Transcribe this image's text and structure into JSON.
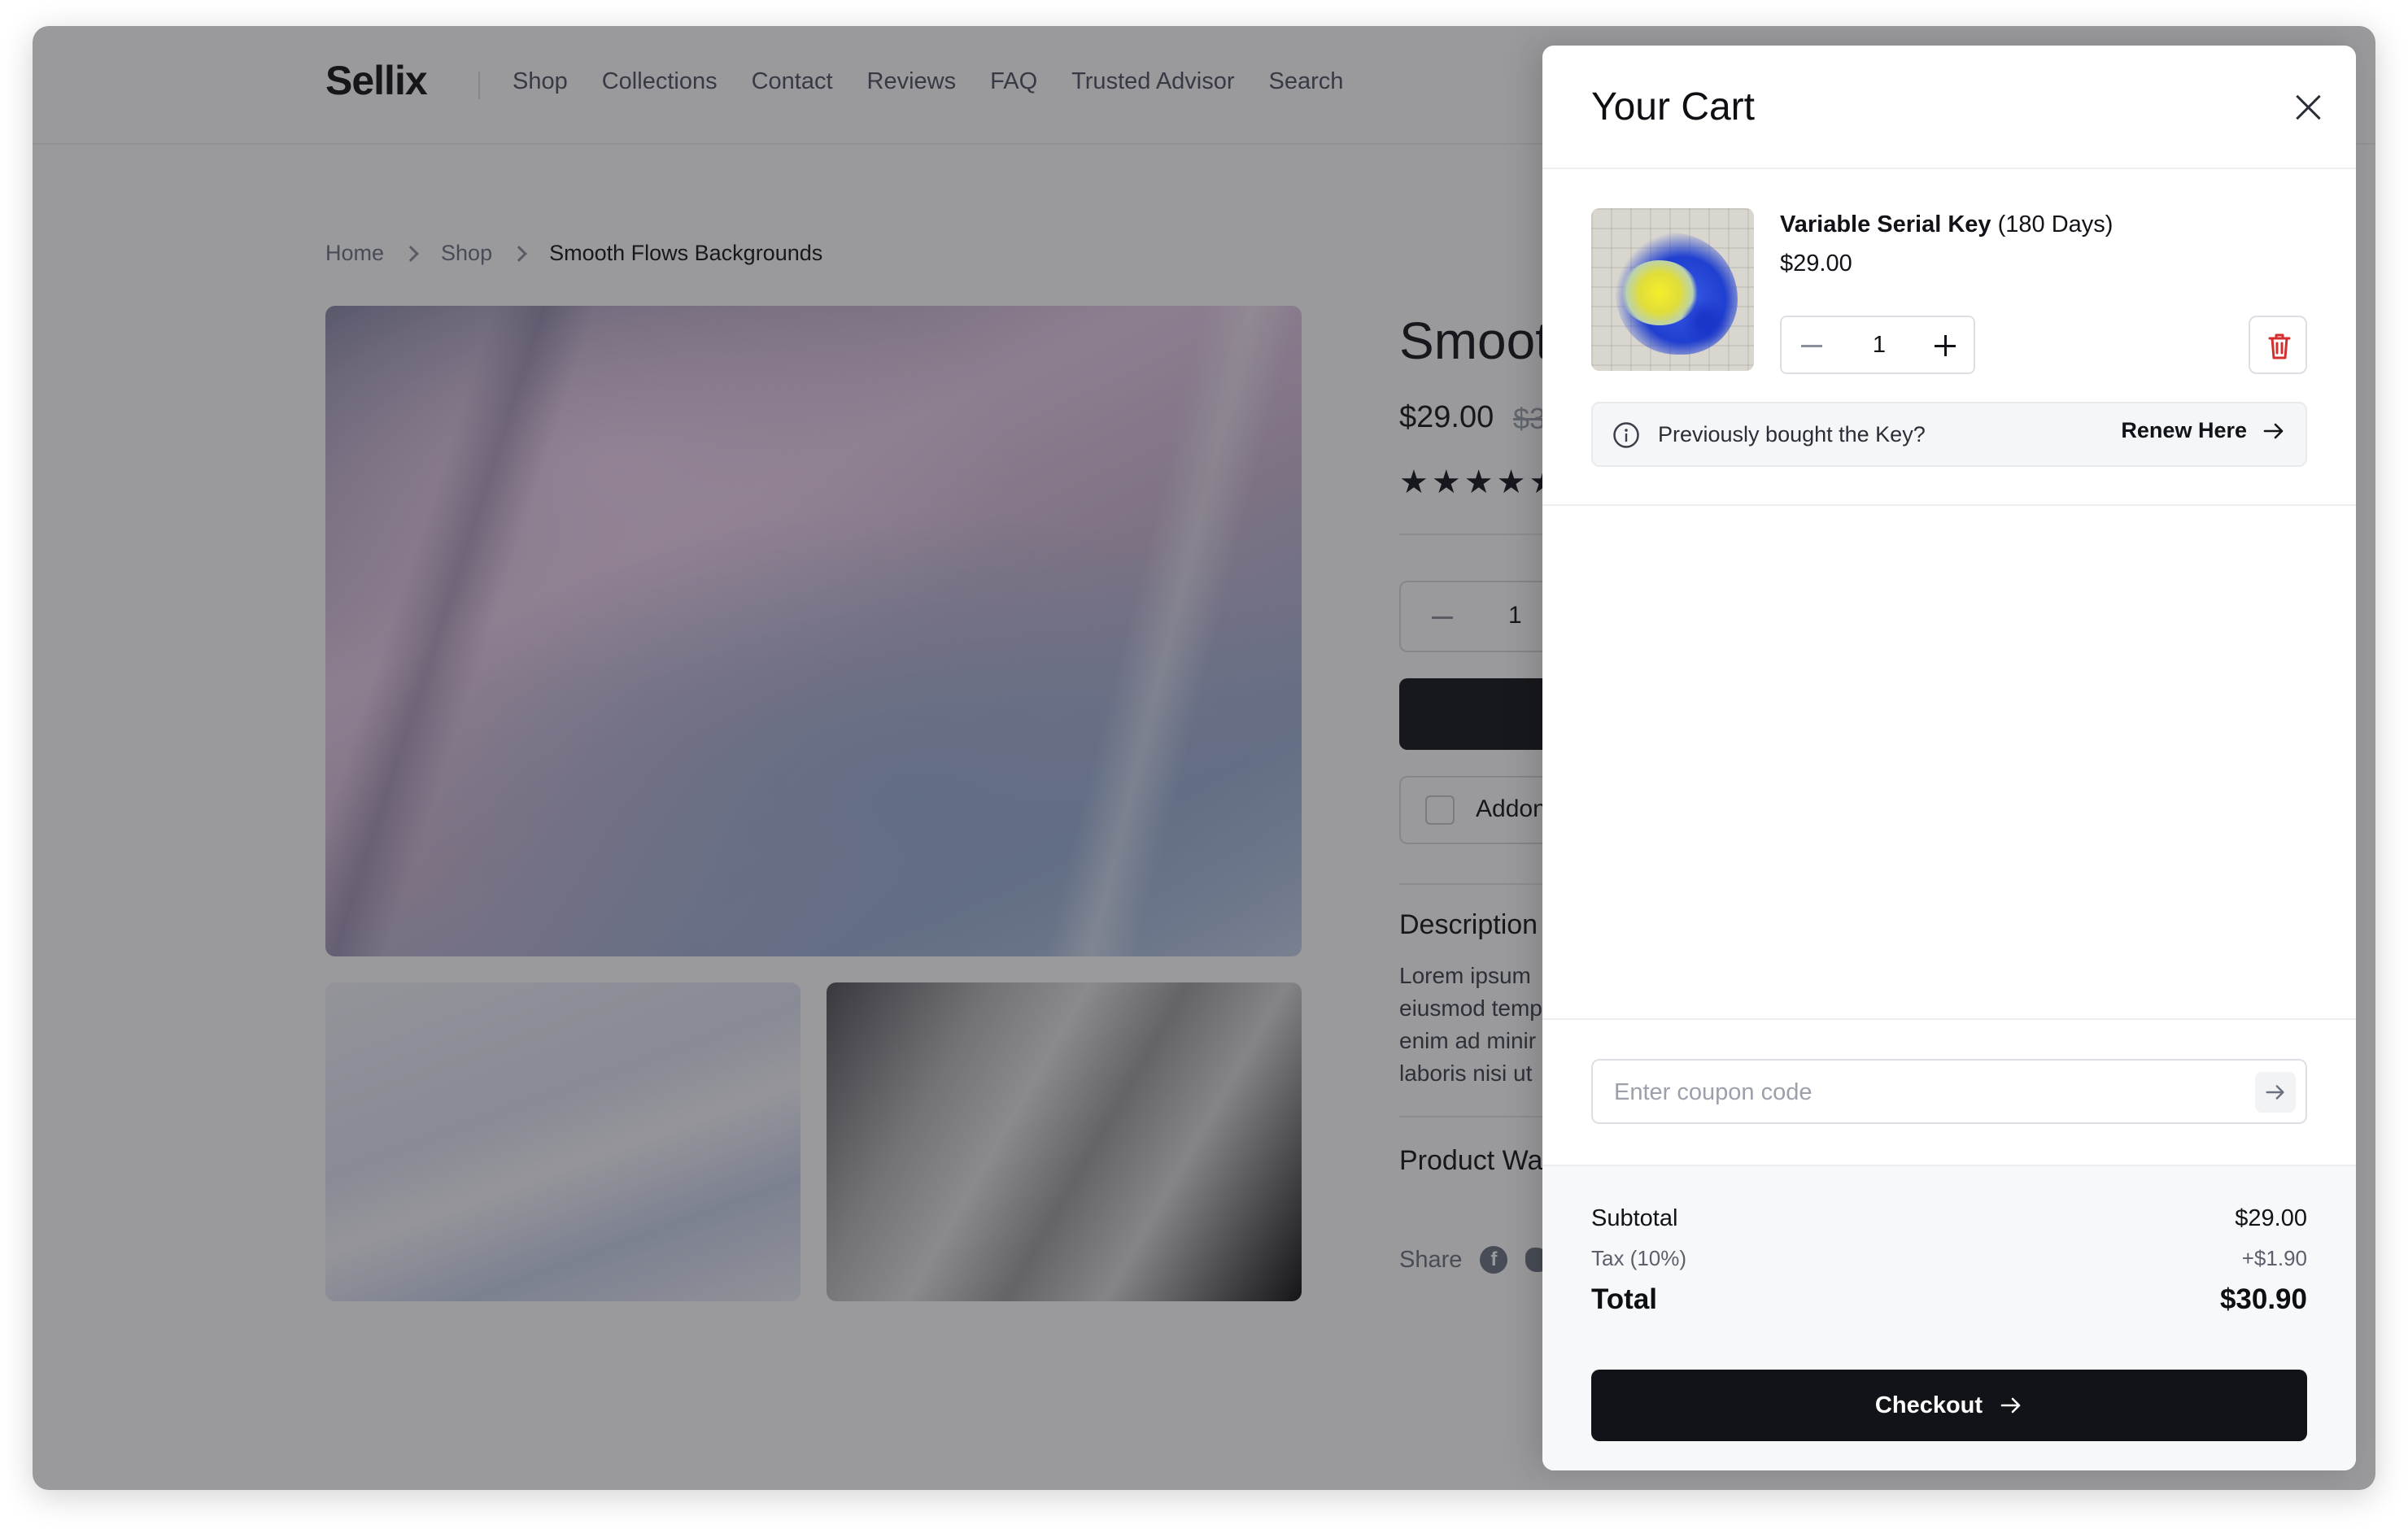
{
  "site": {
    "logo": "Sellix",
    "nav": [
      "Shop",
      "Collections",
      "Contact",
      "Reviews",
      "FAQ",
      "Trusted Advisor",
      "Search"
    ]
  },
  "breadcrumb": [
    "Home",
    "Shop",
    "Smooth Flows Backgrounds"
  ],
  "product": {
    "title_visible": "Smoot",
    "price": "$29.00",
    "old_price": "$3",
    "stars": "★★★★★",
    "qty": "1",
    "addon_label": "Addon",
    "description_heading": "Description",
    "description_lines": [
      "Lorem ipsum",
      "eiusmod temp",
      "enim ad minir",
      "laboris nisi ut"
    ],
    "warranty_heading": "Product Wa",
    "share_label": "Share"
  },
  "cart": {
    "title": "Your Cart",
    "item": {
      "name_bold": "Variable Serial Key",
      "name_suffix": " (180 Days)",
      "price": "$29.00",
      "qty": "1"
    },
    "renew": {
      "text": "Previously bought the Key?",
      "link": "Renew Here"
    },
    "coupon_placeholder": "Enter coupon code",
    "subtotal_label": "Subtotal",
    "subtotal": "$29.00",
    "tax_label": "Tax (10%)",
    "tax": "+$1.90",
    "total_label": "Total",
    "total": "$30.90",
    "checkout_label": "Checkout"
  },
  "colors": {
    "accent": "#111318",
    "delete": "#d32f2f",
    "overlay": "rgba(30,32,36,0.45)"
  }
}
